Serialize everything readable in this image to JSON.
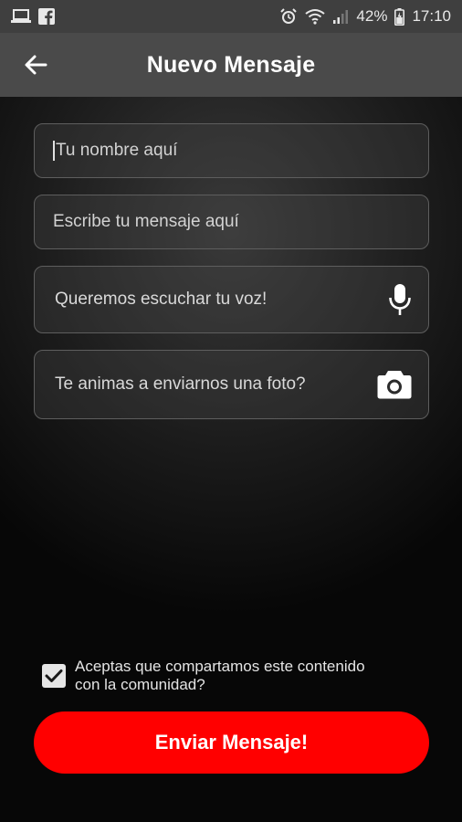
{
  "status_bar": {
    "battery": "42%",
    "time": "17:10",
    "icons_left": [
      "laptop-icon",
      "facebook-icon"
    ],
    "icons_right": [
      "alarm-icon",
      "wifi-icon",
      "signal-icon",
      "battery-icon"
    ]
  },
  "app_bar": {
    "title": "Nuevo Mensaje",
    "back_icon": "arrow-back-icon"
  },
  "form": {
    "name_placeholder": "Tu nombre aquí",
    "message_placeholder": "Escribe tu mensaje aquí",
    "voice_label": "Queremos escuchar tu voz!",
    "voice_icon": "microphone-icon",
    "photo_label": "Te animas a enviarnos una foto?",
    "photo_icon": "camera-icon"
  },
  "consent": {
    "checked": true,
    "line1": "Aceptas que compartamos este contenido",
    "line2": "con la comunidad?"
  },
  "send_button": {
    "label": "Enviar Mensaje!"
  },
  "colors": {
    "accent": "#ff0000",
    "app_bar": "#4a4a4a",
    "status_bar": "#3f3f3f"
  }
}
